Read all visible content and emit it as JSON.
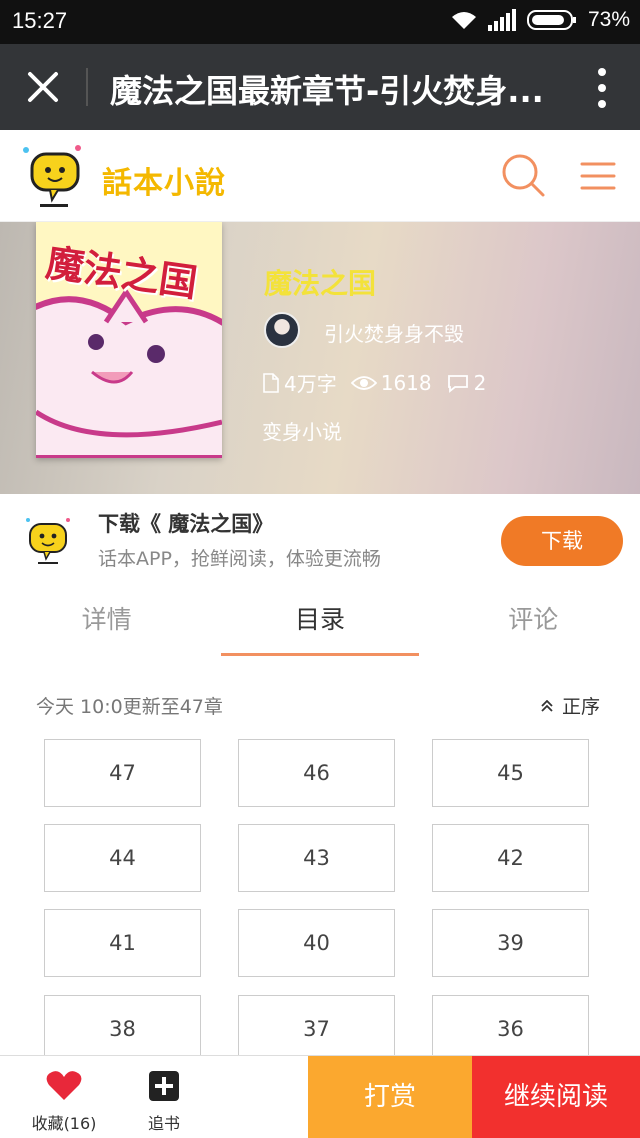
{
  "status_bar": {
    "time": "15:27",
    "battery": "73%"
  },
  "webview": {
    "title": "魔法之国最新章节-引火焚身..."
  },
  "site": {
    "logo_text": "話本小說",
    "accent": "#f29060"
  },
  "book": {
    "title": "魔法之国",
    "cover_title": "魔法之国",
    "author": "引火焚身身不毁",
    "words": "4万字",
    "views": "1618",
    "comments": "2",
    "genre": "变身小说"
  },
  "download": {
    "title": "下载《 魔法之国》",
    "subtitle": "话本APP，抢鲜阅读，体验更流畅",
    "button": "下载"
  },
  "tabs": [
    {
      "label": "详情"
    },
    {
      "label": "目录"
    },
    {
      "label": "评论"
    }
  ],
  "active_tab": "目录",
  "chapters": {
    "update_text": "今天 10:0更新至47章",
    "sort_label": "正序",
    "items": [
      "47",
      "46",
      "45",
      "44",
      "43",
      "42",
      "41",
      "40",
      "39",
      "38",
      "37",
      "36"
    ]
  },
  "bottom": {
    "favorite": "收藏(16)",
    "follow": "追书",
    "tip": "打赏",
    "continue": "继续阅读"
  },
  "colors": {
    "download": "#f07a26",
    "tip": "#fba82f",
    "continue": "#f2302e",
    "title_yellow": "#f3e23a"
  }
}
